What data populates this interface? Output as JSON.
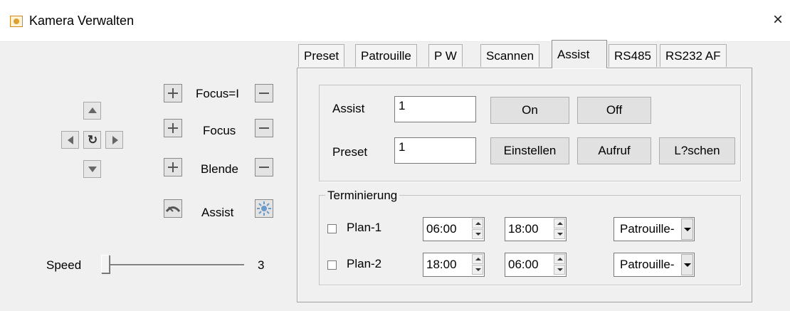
{
  "window": {
    "title": "Kamera Verwalten",
    "close_symbol": "×"
  },
  "ptz": {
    "labels": {
      "zoom": "Focus=I",
      "focus": "Focus",
      "iris": "Blende",
      "assist": "Assist"
    },
    "speed": {
      "label": "Speed",
      "value": "3",
      "level": 0.0
    }
  },
  "tabs": [
    {
      "label": "Preset",
      "active": false
    },
    {
      "label": "Patrouille",
      "active": false
    },
    {
      "label": "P  W",
      "active": false
    },
    {
      "label": "Scannen",
      "active": false
    },
    {
      "label": "Assist",
      "active": true
    },
    {
      "label": "RS485",
      "active": false
    },
    {
      "label": "RS232  AF",
      "active": false
    }
  ],
  "assist_group": {
    "assist_label": "Assist",
    "assist_value": "1",
    "on_label": "On",
    "off_label": "Off",
    "preset_label": "Preset",
    "preset_value": "1",
    "set_label": "Einstellen",
    "call_label": "Aufruf",
    "delete_label": "L?schen"
  },
  "schedule": {
    "title": "Terminierung",
    "plans": [
      {
        "label": "Plan-1",
        "checked": false,
        "start": "06:00",
        "end": "18:00",
        "mode": "Patrouille-"
      },
      {
        "label": "Plan-2",
        "checked": false,
        "start": "18:00",
        "end": "06:00",
        "mode": "Patrouille-"
      }
    ]
  },
  "colors": {
    "window_bg": "#f0f0f0",
    "titlebar_bg": "#ffffff",
    "icon_accent": "#e0a030"
  }
}
